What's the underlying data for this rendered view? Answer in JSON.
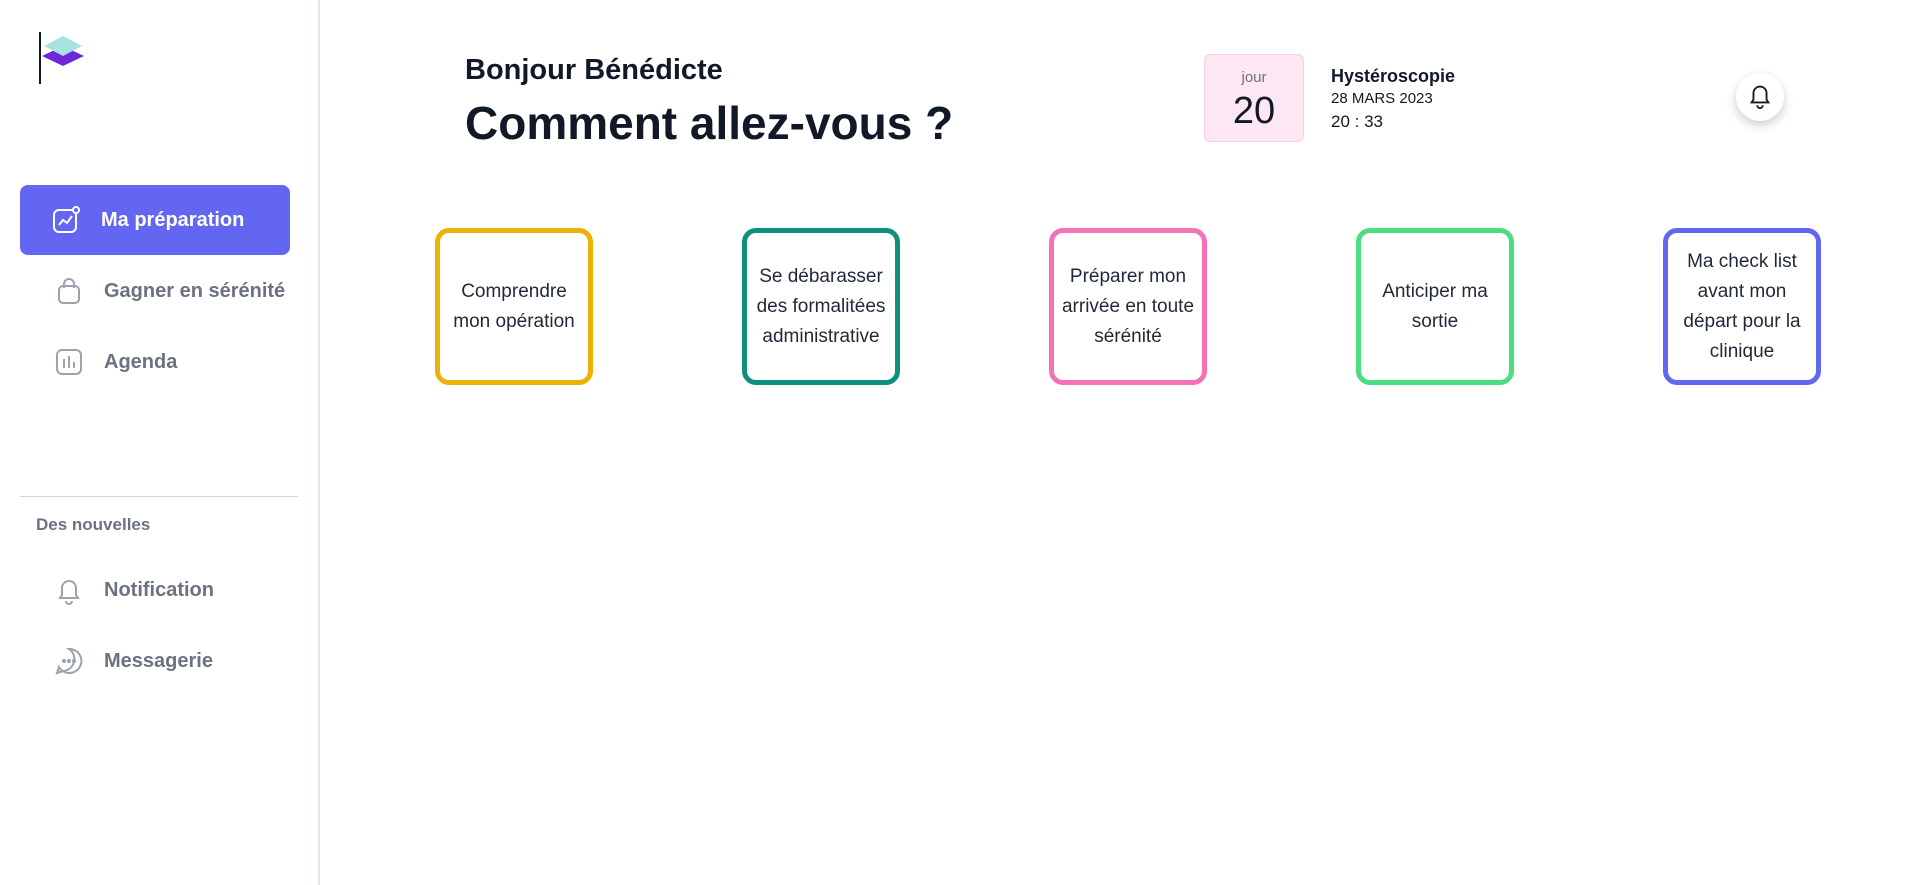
{
  "sidebar": {
    "items": [
      {
        "label": "Ma préparation",
        "icon": "chart-icon",
        "active": true
      },
      {
        "label": "Gagner en sérénité",
        "icon": "bag-icon",
        "active": false
      },
      {
        "label": "Agenda",
        "icon": "bar-chart-icon",
        "active": false
      }
    ],
    "section_title": "Des nouvelles",
    "bottom_items": [
      {
        "label": "Notification",
        "icon": "bell-icon"
      },
      {
        "label": "Messagerie",
        "icon": "message-icon"
      }
    ]
  },
  "header": {
    "greeting": "Bonjour Bénédicte",
    "headline": "Comment allez-vous ?",
    "day_label": "jour",
    "day_value": "20",
    "procedure": "Hystéroscopie",
    "date": "28 MARS 2023",
    "time": "20 : 33"
  },
  "cards": [
    {
      "text": "Comprendre mon opération",
      "color": "#eab308"
    },
    {
      "text": "Se débarasser des formalitées administrative",
      "color": "#0f8f7e"
    },
    {
      "text": "Préparer mon arrivée en toute sérénité",
      "color": "#f472b6"
    },
    {
      "text": "Anticiper ma sortie",
      "color": "#4ade80"
    },
    {
      "text": "Ma check list avant mon départ pour la clinique",
      "color": "#6366f1"
    }
  ],
  "colors": {
    "accent": "#6366f1",
    "day_box_bg": "#fce7f3"
  }
}
